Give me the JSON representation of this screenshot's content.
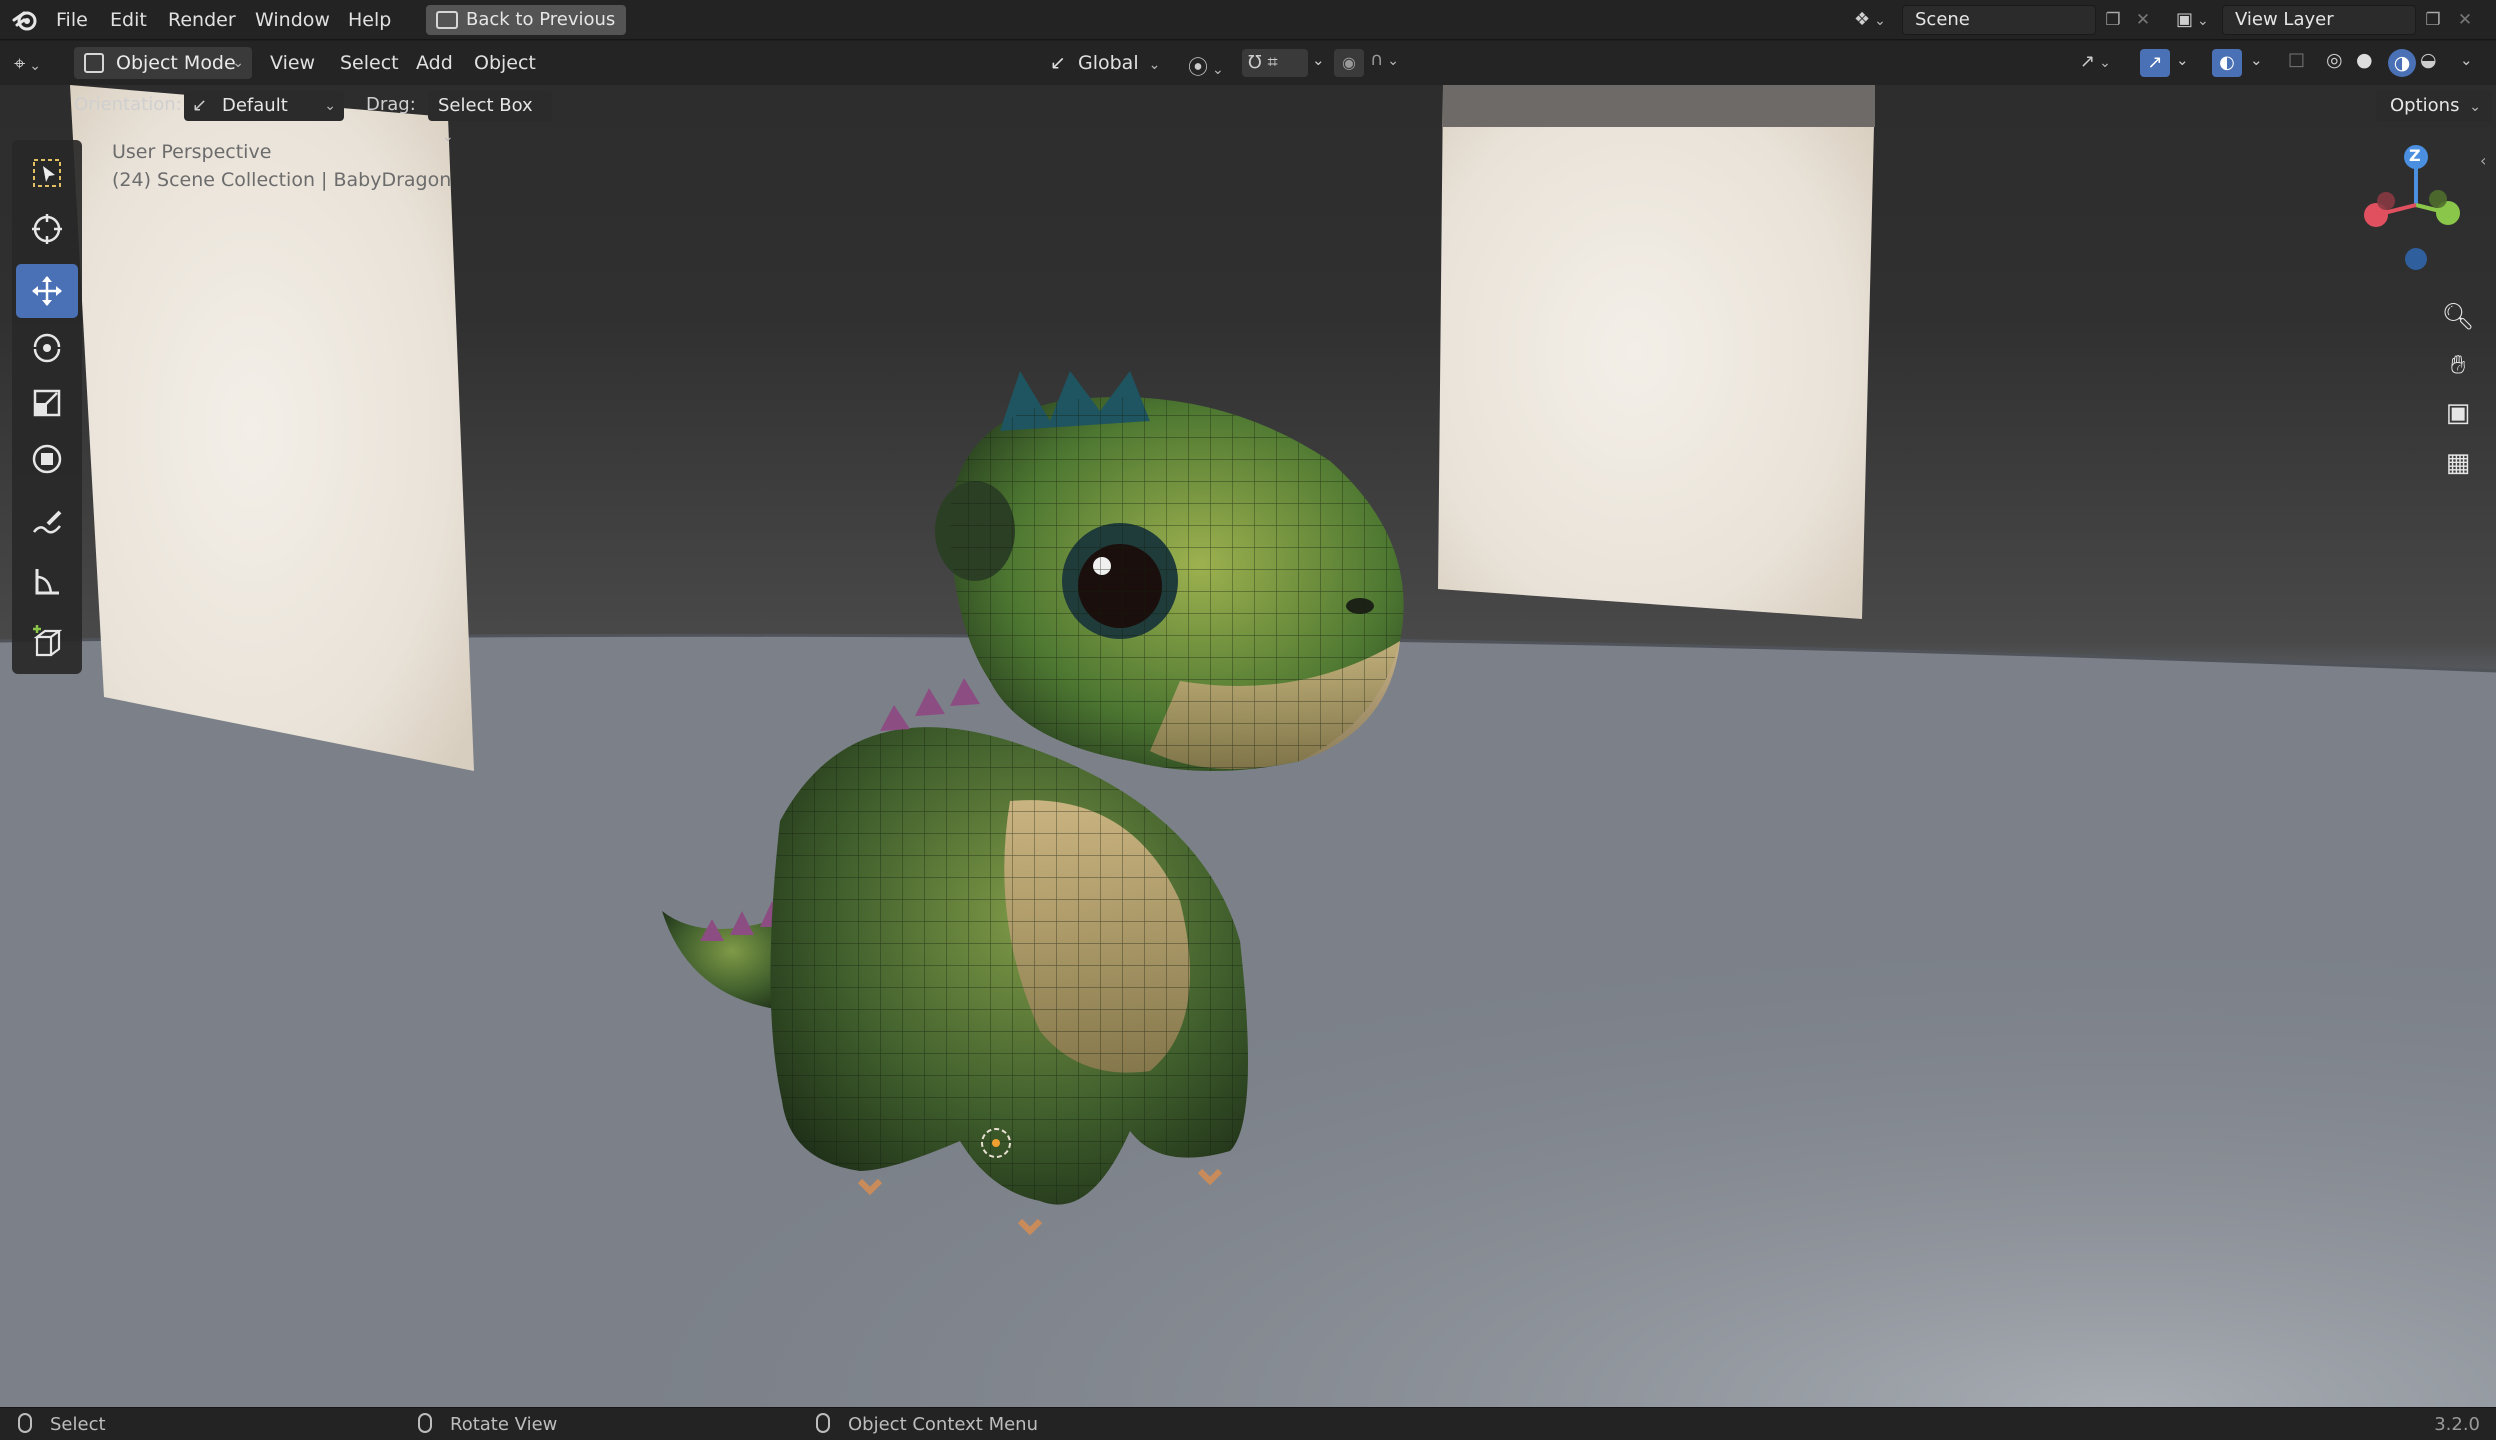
{
  "topbar": {
    "menus": [
      "File",
      "Edit",
      "Render",
      "Window",
      "Help"
    ],
    "back_button": "Back to Previous",
    "scene_name": "Scene",
    "view_layer": "View Layer"
  },
  "header": {
    "mode": "Object Mode",
    "menus": [
      "View",
      "Select",
      "Add",
      "Object"
    ],
    "transform_orientation": "Global",
    "options_label": "Options"
  },
  "tool_settings": {
    "orientation_label": "Orientation:",
    "orientation_value": "Default",
    "drag_label": "Drag:",
    "drag_value": "Select Box"
  },
  "viewport": {
    "perspective": "User Perspective",
    "collection": "(24) Scene Collection | BabyDragon"
  },
  "gizmo": {
    "z_label": "Z"
  },
  "toolbar": {
    "tools": [
      "select-box",
      "cursor",
      "move",
      "rotate",
      "scale",
      "transform",
      "annotate",
      "measure",
      "add-cube"
    ],
    "active": "move"
  },
  "statusbar": {
    "left": "Select",
    "middle": "Rotate View",
    "right": "Object Context Menu",
    "version": "3.2.0"
  },
  "colors": {
    "accent": "#4a70b5",
    "axis_x": "#e0505f",
    "axis_y": "#8ac64a",
    "axis_z": "#4b8fe0"
  }
}
